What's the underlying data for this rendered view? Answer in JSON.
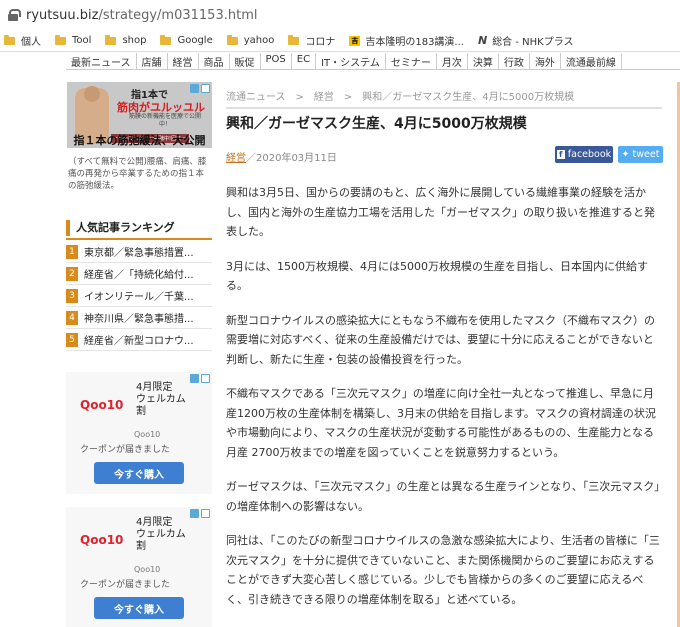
{
  "browser": {
    "url_host": "ryutsuu.biz",
    "url_path": "/strategy/m031153.html",
    "bookmarks": [
      {
        "label": "個人",
        "icon": "folder-icon"
      },
      {
        "label": "Tool",
        "icon": "folder-icon"
      },
      {
        "label": "shop",
        "icon": "folder-icon"
      },
      {
        "label": "Google",
        "icon": "folder-icon"
      },
      {
        "label": "yahoo",
        "icon": "folder-icon"
      },
      {
        "label": "コロナ",
        "icon": "folder-icon"
      },
      {
        "label": "吉本隆明の183講演...",
        "icon": "yoshimoto-favicon"
      },
      {
        "label": "総合 - NHKプラス",
        "icon": "nhk-favicon"
      }
    ]
  },
  "nav": [
    "最新ニュース",
    "店舗",
    "経営",
    "商品",
    "販促",
    "POS",
    "EC",
    "IT・システム",
    "セミナー",
    "月次",
    "決算",
    "行政",
    "海外",
    "流通最前線"
  ],
  "sidebar": {
    "ad1": {
      "line1": "指1本で",
      "line2": "筋肉がユルッユル",
      "line3": "筋膜の新機能を医療で公開中！",
      "line4": "一無料でセミナー視聴中!回目一",
      "title": "指１本の筋弛緩法、大公開",
      "desc": "（すべて無料で公開)腰痛、肩痛、膝痛の再発から卒業するための指１本の筋弛緩法。"
    },
    "ranking_title": "人気記事ランキング",
    "ranking": [
      {
        "num": "1",
        "text": "東京都／緊急事態措置..."
      },
      {
        "num": "2",
        "text": "経産省／「持続化給付..."
      },
      {
        "num": "3",
        "text": "イオンリテール／千葉..."
      },
      {
        "num": "4",
        "text": "神奈川県／緊急事態措..."
      },
      {
        "num": "5",
        "text": "経産省／新型コロナウ..."
      }
    ],
    "ads": [
      {
        "brand": "Qoo10",
        "headline": "4月限定\nウェルカム\n割",
        "sub": "Qoo10",
        "note": "クーポンが届きました",
        "button": "今すぐ購入"
      },
      {
        "brand": "Qoo10",
        "headline": "4月限定\nウェルカム\n割",
        "sub": "Qoo10",
        "note": "クーポンが届きました",
        "button": "今すぐ購入"
      }
    ]
  },
  "article": {
    "breadcrumb": "流通ニュース　>　経営　>　興和／ガーゼマスク生産、4月に5000万枚規模",
    "title": "興和／ガーゼマスク生産、4月に5000万枚規模",
    "category": "経営",
    "date": "／2020年03月11日",
    "share_facebook": "facebook",
    "share_tweet": "tweet",
    "paragraphs": [
      "興和は3月5日、国からの要請のもと、広く海外に展開している繊維事業の経験を活かし、国内と海外の生産協力工場を活用した「ガーゼマスク」の取り扱いを推進すると発表した。",
      "3月には、1500万枚規模、4月には5000万枚規模の生産を目指し、日本国内に供給する。",
      "新型コロナウイルスの感染拡大にともなう不織布を使用したマスク（不織布マスク）の需要増に対応すべく、従来の生産設備だけでは、要望に十分に応えることができないと判断し、新たに生産・包装の設備投資を行った。",
      "不織布マスクである「三次元マスク」の増産に向け全社一丸となって推進し、早急に月産1200万枚の生産体制を構築し、3月末の供給を目指します。マスクの資材調達の状況や市場動向により、マスクの生産状況が変動する可能性があるものの、生産能力となる月産 2700万枚までの増産を図っていくことを鋭意努力するという。",
      "ガーゼマスクは、「三次元マスク」の生産とは異なる生産ラインとなり、「三次元マスク」の増産体制への影響はない。",
      "同社は、「このたびの新型コロナウイルスの急激な感染拡大により、生活者の皆様に「三次元マスク」を十分に提供できていないこと、また関係機関からのご要望にお応えすることができず大変心苦しく感じている。少しでも皆様からの多くのご要望に応えるべく、引き続きできる限りの増産体制を取る」と述べている。"
    ]
  }
}
